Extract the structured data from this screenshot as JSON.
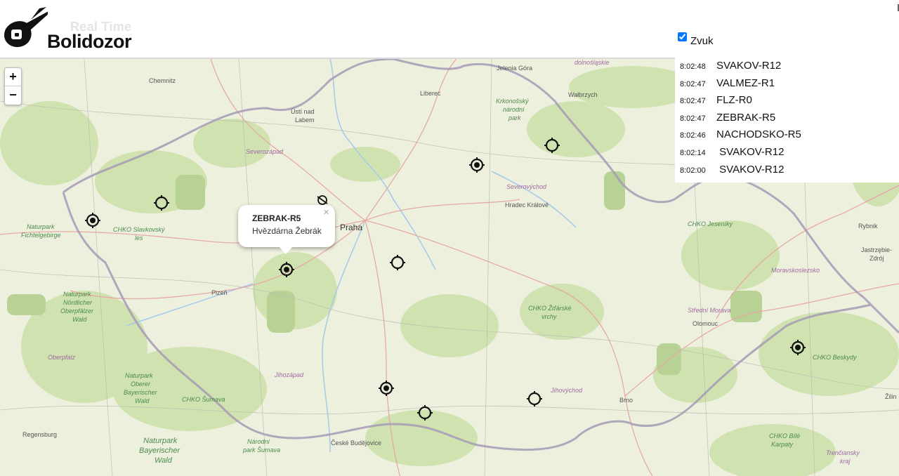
{
  "header": {
    "logo_tagline": "Real Time",
    "logo_name": "Bolidozor"
  },
  "map": {
    "zoom_in_label": "+",
    "zoom_out_label": "−",
    "place_labels": {
      "chemnitz": "Chemnitz",
      "usti_line1": "Ústí nad",
      "usti_line2": "Labem",
      "liberec": "Liberec",
      "jelenia_gora": "Jelenia Góra",
      "dolnoslaskie": "dolnośląskie",
      "walbrzych": "Wałbrzych",
      "krkonose_1": "Krkonošský",
      "krkonose_2": "národní",
      "krkonose_3": "park",
      "severozapad": "Severozápad",
      "severovychod": "Severovýchod",
      "hradec": "Hradec Králové",
      "praha": "Praha",
      "fichtel_1": "Naturpark",
      "fichtel_2": "Fichtelgebirge",
      "slavkov_1": "CHKO Slavkovský",
      "slavkov_2": "les",
      "plzen": "Plzeň",
      "oberpf_1": "Naturpark",
      "oberpf_2": "Nördlicher",
      "oberpf_3": "Oberpfälzer",
      "oberpf_4": "Wald",
      "oberpfalz": "Oberpfalz",
      "obwald_1": "Naturpark",
      "obwald_2": "Oberer",
      "obwald_3": "Bayerischer",
      "obwald_4": "Wald",
      "jihozapad": "Jihozápad",
      "sumava": "CHKO Šumava",
      "regensburg": "Regensburg",
      "bayer_1": "Naturpark",
      "bayer_2": "Bayerischer",
      "bayer_3": "Wald",
      "np_sumava_1": "Národní",
      "np_sumava_2": "park Šumava",
      "budejovice": "České Budějovice",
      "zdarske_1": "CHKO Žďárské",
      "zdarske_2": "vrchy",
      "jihovychod": "Jihovýchod",
      "brno": "Brno",
      "jeseniky": "CHKO Jeseníky",
      "rybnik": "Rybnik",
      "jastrzebie_1": "Jastrzębie-",
      "jastrzebie_2": "Zdrój",
      "moravskoslezsko": "Moravskoslezsko",
      "stredni_morava": "Střední Morava",
      "olomouc": "Olomouc",
      "beskydy": "CHKO Beskydy",
      "bile_karpaty_1": "CHKO Bílé",
      "bile_karpaty_2": "Karpaty",
      "trencin_1": "Trenčiansky",
      "trencin_2": "kraj",
      "zilina": "Žilin"
    },
    "popup": {
      "title": "ZEBRAK-R5",
      "subtitle": "Hvězdárna Žebrák",
      "close_label": "×"
    }
  },
  "panel": {
    "sound_label": "Zvuk",
    "sound_checked": true,
    "events": [
      {
        "time": "8:02:48",
        "station": "SVAKOV-R12"
      },
      {
        "time": "8:02:47",
        "station": "VALMEZ-R1"
      },
      {
        "time": "8:02:47",
        "station": "FLZ-R0"
      },
      {
        "time": "8:02:47",
        "station": "ZEBRAK-R5"
      },
      {
        "time": "8:02:46",
        "station": "NACHODSKO-R5"
      },
      {
        "time": "8:02:14",
        "station": " SVAKOV-R12"
      },
      {
        "time": "8:02:00",
        "station": " SVAKOV-R12"
      }
    ]
  },
  "colors": {
    "land": "#eef0de",
    "forest": "#c9dfa9",
    "park": "#b7cf90",
    "border": "#a49ab6",
    "road": "#e6a9a5",
    "river": "#a8cbe8"
  }
}
